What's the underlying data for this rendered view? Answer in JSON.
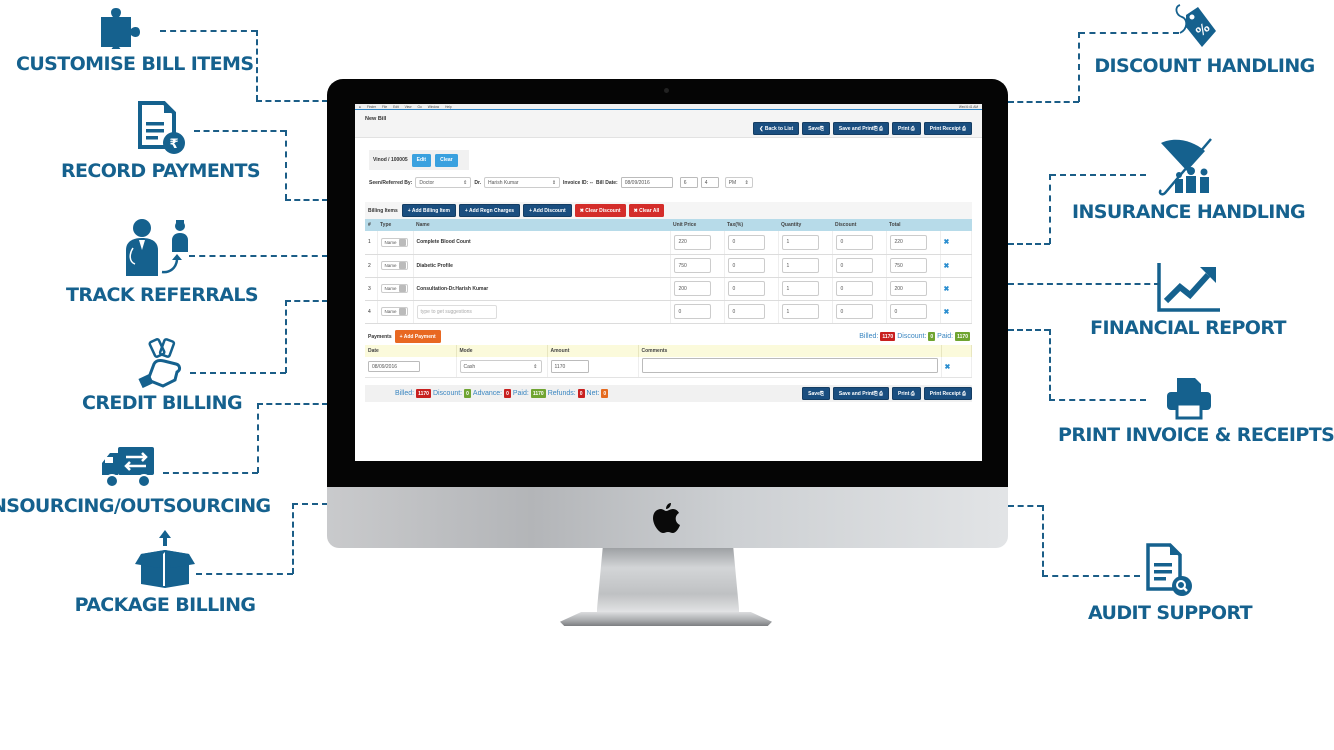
{
  "features": {
    "customise_bill_items": "CUSTOMISE BILL ITEMS",
    "record_payments": "RECORD PAYMENTS",
    "track_referrals": "TRACK REFERRALS",
    "credit_billing": "CREDIT BILLING",
    "insourcing_outsourcing": "INSOURCING/OUTSOURCING",
    "package_billing": "PACKAGE BILLING",
    "discount_handling": "DISCOUNT HANDLING",
    "insurance_handling": "INSURANCE HANDLING",
    "financial_report": "FINANCIAL REPORT",
    "print_invoice_receipts": "PRINT INVOICE & RECEIPTS",
    "audit_support": "AUDIT SUPPORT"
  },
  "colors": {
    "brand_blue": "#15618e",
    "navy_button": "#1a4e7f",
    "light_button": "#3aa1df",
    "danger": "#d42d2a",
    "payment_orange": "#e86822",
    "success_badge": "#6fa431"
  },
  "menubar": {
    "items": [
      "Finder",
      "File",
      "Edit",
      "View",
      "Go",
      "Window",
      "Help"
    ],
    "right": "Wed 6:41 AM"
  },
  "page": {
    "title": "New Bill",
    "buttons": {
      "back": "❮ Back to List",
      "save": "Save⎘",
      "save_print": "Save and Print⎘ ⎙",
      "print": "Print ⎙",
      "print_receipt": "Print Receipt ⎙"
    }
  },
  "patient": {
    "name": "Vinod / 100005",
    "edit": "Edit",
    "clear": "Clear"
  },
  "referral": {
    "seen_label": "Seen/Referred By:",
    "seen_value": "Doctor",
    "dr_label": "Dr.",
    "dr_value": "Harish Kumar",
    "invoice_label": "Invoice ID: --",
    "bill_date_label": "Bill Date:",
    "bill_date": "08/09/2016",
    "hour": "6",
    "minute": "4",
    "ampm": "PM"
  },
  "billing": {
    "label": "Billing Items",
    "actions": {
      "add_item": "+ Add Billing Item",
      "add_regn": "+ Add Regn Charges",
      "add_discount": "+ Add Discount",
      "clear_discount": "✖ Clear Discount",
      "clear_all": "✖ Clear All"
    },
    "columns": [
      "#",
      "Type",
      "Name",
      "Unit Price",
      "Tax(%)",
      "Quantity",
      "Discount",
      "Total"
    ],
    "rows": [
      {
        "num": "1",
        "type": "Name",
        "name": "Complete Blood Count",
        "unit_price": "220",
        "tax": "0",
        "qty": "1",
        "discount": "0",
        "total": "220"
      },
      {
        "num": "2",
        "type": "Name",
        "name": "Diabetic Profile",
        "unit_price": "750",
        "tax": "0",
        "qty": "1",
        "discount": "0",
        "total": "750"
      },
      {
        "num": "3",
        "type": "Name",
        "name": "Consultation-Dr.Harish Kumar",
        "unit_price": "200",
        "tax": "0",
        "qty": "1",
        "discount": "0",
        "total": "200"
      },
      {
        "num": "4",
        "type": "Name",
        "name": "",
        "placeholder": "type to get suggestions",
        "unit_price": "0",
        "tax": "0",
        "qty": "1",
        "discount": "0",
        "total": "0"
      }
    ],
    "delete_glyph": "✖"
  },
  "payments": {
    "label": "Payments",
    "add": "+ Add Payment",
    "summary": {
      "billed_label": "Billed:",
      "billed": "1170",
      "discount_label": "Discount:",
      "discount": "0",
      "paid_label": "Paid:",
      "paid": "1170"
    },
    "columns": [
      "Date",
      "Mode",
      "Amount",
      "Comments"
    ],
    "row": {
      "date": "08/09/2016",
      "mode": "Cash",
      "amount": "1170",
      "comments": ""
    }
  },
  "footer": {
    "billed_label": "Billed:",
    "billed": "1170",
    "discount_label": "Discount:",
    "discount": "0",
    "advance_label": "Advance:",
    "advance": "0",
    "paid_label": "Paid:",
    "paid": "1170",
    "refunds_label": "Refunds:",
    "refunds": "0",
    "net_label": "Net:",
    "net": "0"
  }
}
